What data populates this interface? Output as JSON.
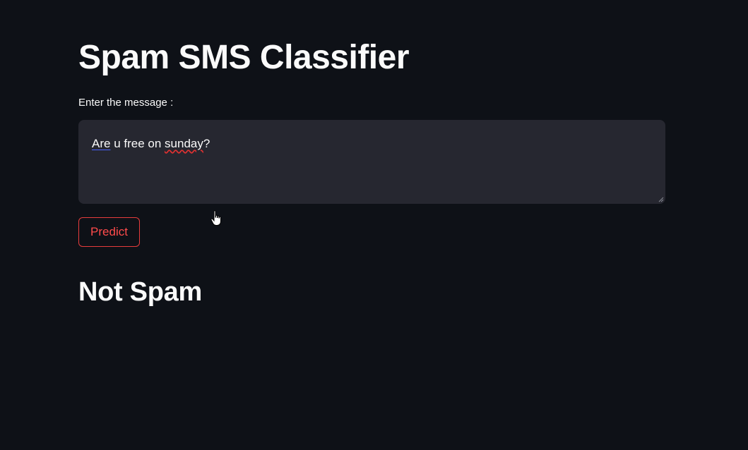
{
  "app": {
    "title": "Spam SMS Classifier"
  },
  "form": {
    "label": "Enter the message :",
    "message_tokens": {
      "t1": "Are",
      "t2": " u free on ",
      "t3": "sunday",
      "t4": "?"
    },
    "predict_label": "Predict"
  },
  "result": {
    "text": "Not Spam"
  },
  "colors": {
    "background": "#0e1117",
    "input_background": "#262730",
    "accent": "#ff4b4b",
    "text": "#fafafa"
  },
  "icons": {
    "cursor": "hand-pointer-icon",
    "resize": "resize-handle-icon"
  }
}
